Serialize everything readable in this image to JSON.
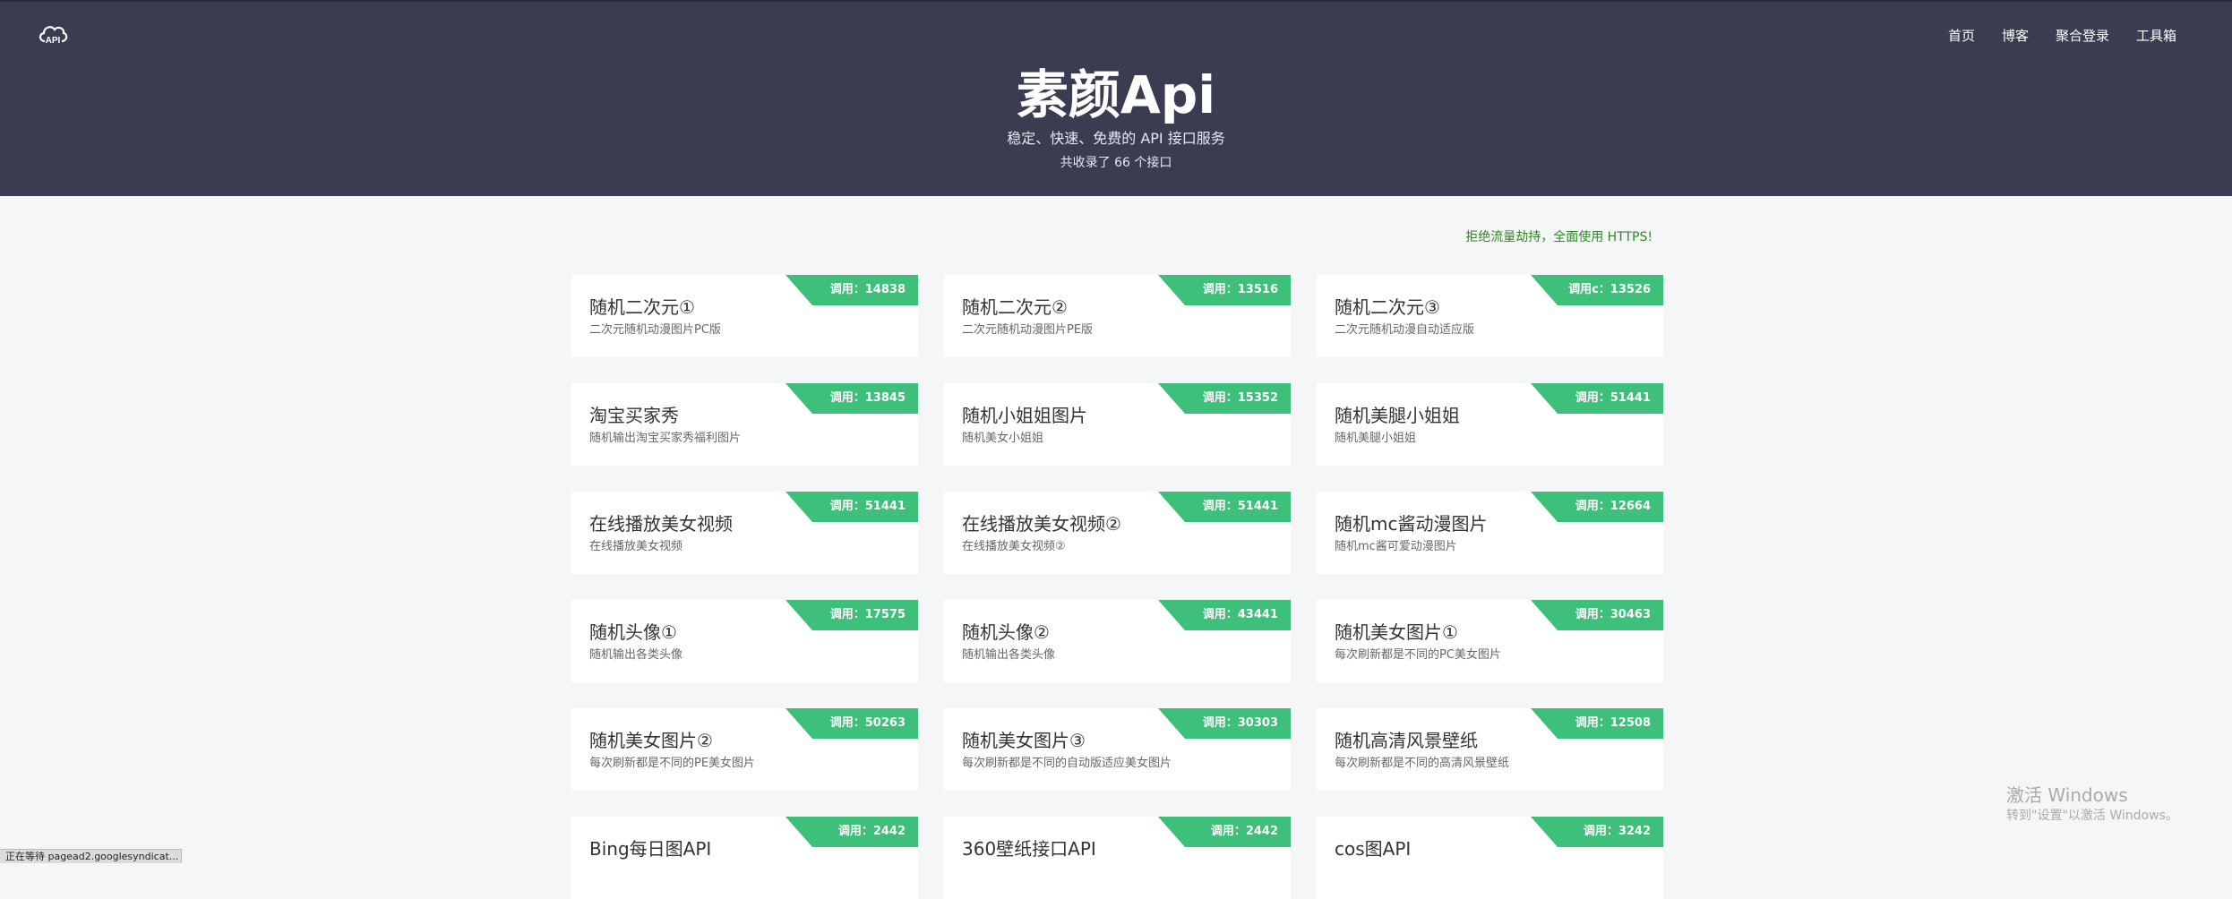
{
  "header": {
    "logo_text": "API",
    "nav": [
      "首页",
      "博客",
      "聚合登录",
      "工具箱"
    ],
    "title": "素颜Api",
    "subtitle": "稳定、快速、免费的 API 接口服务",
    "count": "共收录了 66 个接口"
  },
  "notice": "拒绝流量劫持，全面使用 HTTPS!",
  "cards": [
    {
      "title": "随机二次元①",
      "desc": "二次元随机动漫图片PC版",
      "badge": "调用：14838"
    },
    {
      "title": "随机二次元②",
      "desc": "二次元随机动漫图片PE版",
      "badge": "调用：13516"
    },
    {
      "title": "随机二次元③",
      "desc": "二次元随机动漫自动适应版",
      "badge": "调用c：13526"
    },
    {
      "title": "淘宝买家秀",
      "desc": "随机输出淘宝买家秀福利图片",
      "badge": "调用：13845"
    },
    {
      "title": "随机小姐姐图片",
      "desc": "随机美女小姐姐",
      "badge": "调用：15352"
    },
    {
      "title": "随机美腿小姐姐",
      "desc": "随机美腿小姐姐",
      "badge": "调用：51441"
    },
    {
      "title": "在线播放美女视频",
      "desc": "在线播放美女视频",
      "badge": "调用：51441"
    },
    {
      "title": "在线播放美女视频②",
      "desc": "在线播放美女视频②",
      "badge": "调用：51441"
    },
    {
      "title": "随机mc酱动漫图片",
      "desc": "随机mc酱可爱动漫图片",
      "badge": "调用：12664"
    },
    {
      "title": "随机头像①",
      "desc": "随机输出各类头像",
      "badge": "调用：17575"
    },
    {
      "title": "随机头像②",
      "desc": "随机输出各类头像",
      "badge": "调用：43441"
    },
    {
      "title": "随机美女图片①",
      "desc": "每次刷新都是不同的PC美女图片",
      "badge": "调用：30463"
    },
    {
      "title": "随机美女图片②",
      "desc": "每次刷新都是不同的PE美女图片",
      "badge": "调用：50263"
    },
    {
      "title": "随机美女图片③",
      "desc": "每次刷新都是不同的自动版适应美女图片",
      "badge": "调用：30303"
    },
    {
      "title": "随机高清风景壁纸",
      "desc": "每次刷新都是不同的高清风景壁纸",
      "badge": "调用：12508"
    },
    {
      "title": "Bing每日图API",
      "desc": "",
      "badge": "调用：2442"
    },
    {
      "title": "360壁纸接口API",
      "desc": "",
      "badge": "调用：2442"
    },
    {
      "title": "cos图API",
      "desc": "",
      "badge": "调用：3242"
    }
  ],
  "watermark": {
    "line1": "激活 Windows",
    "line2": "转到\"设置\"以激活 Windows。"
  },
  "statusbar": "正在等待 pagead2.googlesyndicat...",
  "colors": {
    "header_bg": "#3a3d52",
    "badge": "#3fc07a",
    "notice": "#2a8a1e"
  }
}
